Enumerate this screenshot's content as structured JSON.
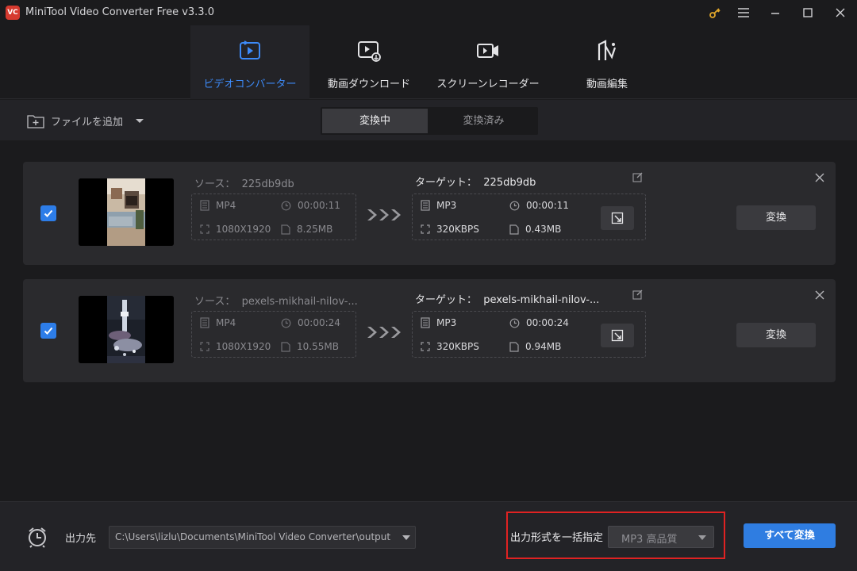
{
  "app": {
    "logo_text": "VC",
    "title": "MiniTool Video Converter Free v3.3.0"
  },
  "window_controls": [
    "key-icon",
    "menu-icon",
    "minimize-icon",
    "maximize-icon",
    "close-icon"
  ],
  "nav": {
    "tabs": [
      {
        "label": "ビデオコンバーター",
        "icon": "convert-icon",
        "active": true
      },
      {
        "label": "動画ダウンロード",
        "icon": "download-icon",
        "active": false
      },
      {
        "label": "スクリーンレコーダー",
        "icon": "camera-icon",
        "active": false
      },
      {
        "label": "動画編集",
        "icon": "edit-video-icon",
        "active": false
      }
    ]
  },
  "toolbar": {
    "add_file_label": "ファイルを追加",
    "tabs": {
      "converting": "変換中",
      "converted": "変換済み"
    }
  },
  "items": [
    {
      "checked": true,
      "source_label": "ソース：",
      "source_name": "225db9db",
      "source": {
        "format": "MP4",
        "duration": "00:00:11",
        "resolution": "1080X1920",
        "size": "8.25MB"
      },
      "target_label": "ターゲット：",
      "target_name": "225db9db",
      "target": {
        "format": "MP3",
        "duration": "00:00:11",
        "bitrate": "320KBPS",
        "size": "0.43MB"
      },
      "convert_label": "変換"
    },
    {
      "checked": true,
      "source_label": "ソース：",
      "source_name": "pexels-mikhail-nilov-...",
      "source": {
        "format": "MP4",
        "duration": "00:00:24",
        "resolution": "1080X1920",
        "size": "10.55MB"
      },
      "target_label": "ターゲット：",
      "target_name": "pexels-mikhail-nilov-...",
      "target": {
        "format": "MP3",
        "duration": "00:00:24",
        "bitrate": "320KBPS",
        "size": "0.94MB"
      },
      "convert_label": "変換"
    }
  ],
  "footer": {
    "output_label": "出力先",
    "output_path": "C:\\Users\\lizlu\\Documents\\MiniTool Video Converter\\output",
    "format_label": "出力形式を一括指定",
    "format_value": "MP3 高品質",
    "convert_all_label": "すべて変換"
  },
  "colors": {
    "accent": "#2f7de1",
    "active_tab_text": "#3d8af7",
    "highlight_frame": "#e02222",
    "background": "#1b1b1d",
    "card": "#2a2a2d"
  }
}
